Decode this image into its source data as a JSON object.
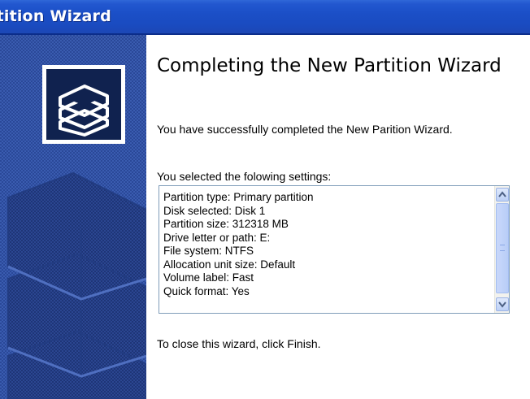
{
  "window": {
    "title": "rtition Wizard"
  },
  "content": {
    "heading": "Completing the New Partition Wizard",
    "success_message": "You have successfully completed the New Parition Wizard.",
    "settings_label": "You selected the folowing settings:",
    "settings": [
      "Partition type: Primary partition",
      "Disk selected: Disk 1",
      "Partition size: 312318 MB",
      "Drive letter or path: E:",
      "File system: NTFS",
      "Allocation unit size: Default",
      "Volume label: Fast",
      "Quick format: Yes"
    ],
    "close_hint": "To close this wizard, click Finish."
  },
  "icons": {
    "wizard_logo": "disk-stack-icon",
    "scroll_up": "arrow-up-icon",
    "scroll_down": "arrow-down-icon"
  },
  "colors": {
    "titlebar": "#1b4fc7",
    "sidebar": "#2c4a9e",
    "scrollbar_thumb": "#c9d8fb"
  }
}
